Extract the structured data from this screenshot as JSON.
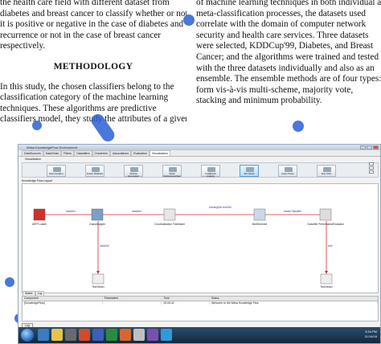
{
  "left_column": {
    "lines": [
      "the health care field with different dataset from",
      "diabetes and breast cancer to classify whether or not",
      "it is positive or negative in the case of diabetes and",
      "recurrence or not in the case of breast cancer",
      "respectively."
    ],
    "heading": "METHODOLOGY",
    "lines2": [
      "In this study, the chosen classifiers belong to the",
      "classification category of the machine learning",
      "techniques.   These   algorithms   are   predictive",
      "classifiers model, they study the attributes of a given"
    ]
  },
  "right_column": {
    "lines": [
      "of machine learning techniques   in both individual and",
      "meta-classification processes, the datasets used",
      "correlate with the domain of computer network",
      "security and health care services. Three datasets",
      "were selected, KDDCup'99, Diabetes, and Breast",
      "Cancer; and the algorithms were trained and tested",
      "with the three datasets individually and also as an",
      "ensemble. The ensemble methods are of four types: in",
      "form   vis-à-vis   multi-scheme,   majority   vote,",
      "stacking and minimum probability."
    ]
  },
  "weka": {
    "window_title": "Weka KnowledgeFlow Environment",
    "tabs": [
      "DataSources",
      "DataSinks",
      "Filters",
      "Classifiers",
      "Clusterers",
      "Associations",
      "Evaluation",
      "Visualization"
    ],
    "active_tab": "Visualization",
    "section_label": "Visualization",
    "tools": [
      "Data Visualizer",
      "Scatter PlotMatrix",
      "Attribute Summarizer",
      "Model PerformanceChart",
      "CostBenefit Analysis",
      "Text Viewer",
      "Graph Viewer",
      "Strip Chart"
    ],
    "canvas_label": "Knowledge Flow Layout",
    "nodes": [
      "ARFFLoader",
      "ClassAssigner",
      "CrossValidation FoldMaker",
      "MultiScheme",
      "Classifier PerformanceEvaluator",
      "TextViewer",
      "TextViewer"
    ],
    "edges": [
      "dataSet",
      "dataSet",
      "trainingSet testSet",
      "batchClassifier",
      "dataSet",
      "text"
    ],
    "status_tabs": [
      "Status",
      "Log"
    ],
    "status_columns": [
      "Component",
      "Parameters",
      "Time",
      "Status"
    ],
    "status_row": [
      "[KnowledgeFlow]",
      "",
      "00:05:42",
      "Welcome to the Weka Knowledge Flow"
    ],
    "log_button": "Log",
    "clock": [
      "3:34 PM",
      "11/14/16"
    ]
  },
  "colors": {
    "watermark": "#2a5fd3",
    "node_red": "#d0312d",
    "selected_tool": "#b9dcf4"
  }
}
